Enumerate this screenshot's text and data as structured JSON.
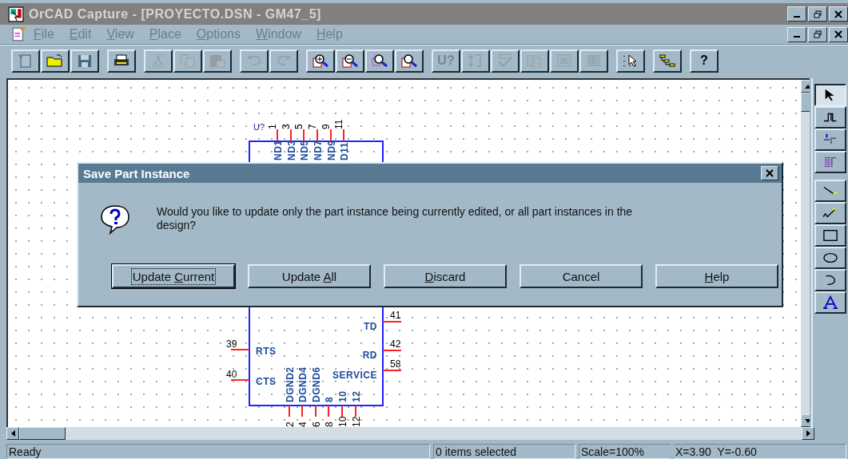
{
  "window": {
    "title": "OrCAD Capture - [PROYECTO.DSN - GM47_5]"
  },
  "menu": [
    {
      "key": "F",
      "post": "ile"
    },
    {
      "key": "E",
      "post": "dit"
    },
    {
      "key": "V",
      "post": "iew"
    },
    {
      "key": "P",
      "post": "lace"
    },
    {
      "key": "O",
      "post": "ptions"
    },
    {
      "key": "W",
      "post": "indow"
    },
    {
      "key": "H",
      "post": "elp"
    }
  ],
  "toolbar": [
    [
      {
        "kind": "new",
        "disabled": false
      },
      {
        "kind": "open",
        "disabled": false
      },
      {
        "kind": "save",
        "disabled": false
      }
    ],
    [
      {
        "kind": "print",
        "disabled": false
      }
    ],
    [
      {
        "kind": "cut",
        "disabled": true
      },
      {
        "kind": "copy",
        "disabled": true
      },
      {
        "kind": "paste",
        "disabled": true
      }
    ],
    [
      {
        "kind": "undo",
        "disabled": true
      },
      {
        "kind": "redo",
        "disabled": true
      }
    ],
    [
      {
        "kind": "zoom-in",
        "disabled": false
      },
      {
        "kind": "zoom-out",
        "disabled": false
      },
      {
        "kind": "zoom-area",
        "disabled": false
      },
      {
        "kind": "zoom-all",
        "disabled": false
      }
    ],
    [
      {
        "kind": "text",
        "label": "U?",
        "disabled": true
      },
      {
        "kind": "annotate",
        "disabled": true
      },
      {
        "kind": "check",
        "disabled": true
      },
      {
        "kind": "netlist",
        "disabled": true
      },
      {
        "kind": "report",
        "disabled": true
      },
      {
        "kind": "table",
        "disabled": true
      }
    ],
    [
      {
        "kind": "select-area",
        "disabled": false
      }
    ],
    [
      {
        "kind": "hierarchy",
        "disabled": false
      }
    ],
    [
      {
        "kind": "text",
        "label": "?",
        "disabled": false
      }
    ]
  ],
  "schematic": {
    "reference": "U?",
    "top_pins": [
      {
        "number": "1",
        "label": "ND1"
      },
      {
        "number": "3",
        "label": "ND3"
      },
      {
        "number": "5",
        "label": "ND5"
      },
      {
        "number": "7",
        "label": "ND7"
      },
      {
        "number": "9",
        "label": "ND9"
      },
      {
        "number": "11",
        "label": "D11"
      }
    ],
    "left_pins": [
      {
        "number": "39",
        "label": "RTS"
      },
      {
        "number": "40",
        "label": "CTS"
      }
    ],
    "right_pins": [
      {
        "number": "41",
        "label": "TD"
      },
      {
        "number": "42",
        "label": "RD"
      },
      {
        "number": "58",
        "label": "SERVICE"
      }
    ],
    "bottom_pins": [
      {
        "number": "2",
        "label": "DGND2"
      },
      {
        "number": "4",
        "label": "DGND4"
      },
      {
        "number": "6",
        "label": "DGND6"
      },
      {
        "number": "8",
        "label": "8"
      },
      {
        "number": "10",
        "label": "10"
      },
      {
        "number": "12",
        "label": "12"
      }
    ]
  },
  "palette": [
    {
      "kind": "pointer",
      "selected": true
    },
    {
      "kind": "part",
      "selected": false
    },
    {
      "kind": "wire",
      "selected": false
    },
    {
      "kind": "bus",
      "selected": false
    },
    {
      "kind": "line",
      "selected": false
    },
    {
      "kind": "polyline",
      "selected": false
    },
    {
      "kind": "rectangle",
      "selected": false
    },
    {
      "kind": "ellipse",
      "selected": false
    },
    {
      "kind": "arc",
      "selected": false
    },
    {
      "kind": "text",
      "selected": false
    }
  ],
  "dialog": {
    "title": "Save Part Instance",
    "message": "Would you like to update only the part instance being currently edited, or all part instances in the design?",
    "buttons": [
      {
        "pre": "Update ",
        "key": "C",
        "post": "urrent",
        "focused": true
      },
      {
        "pre": "Update ",
        "key": "A",
        "post": "ll",
        "focused": false
      },
      {
        "key": "D",
        "post": "iscard",
        "focused": false
      },
      {
        "pre": "Cancel",
        "focused": false
      },
      {
        "key": "H",
        "post": "elp",
        "focused": false
      }
    ]
  },
  "status_bar": {
    "message": "Ready",
    "selection": "0 items selected",
    "scale": "Scale=100%",
    "coordinates": "X=3.90  Y=-0.60"
  }
}
